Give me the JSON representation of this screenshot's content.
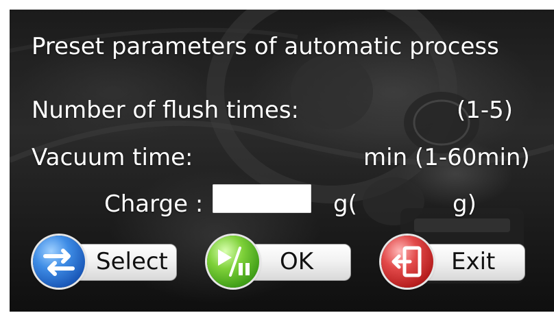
{
  "title": "Preset parameters of automatic process",
  "rows": {
    "flush_label": "Number of flush times:",
    "flush_range": "(1-5)",
    "vacuum_label": "Vacuum time:",
    "vacuum_range": "min (1-60min)",
    "charge_label": "Charge :",
    "charge_unit": "g(",
    "charge_unit_close": "g)",
    "charge_value": ""
  },
  "buttons": {
    "select_label": "Select",
    "ok_label": "OK",
    "exit_label": "Exit"
  },
  "icons": {
    "select": "swap-arrows-icon",
    "ok": "play-pause-icon",
    "exit": "exit-door-icon"
  },
  "colors": {
    "text": "#ffffff",
    "select_accent": "#1a58b8",
    "ok_accent": "#3f9d17",
    "exit_accent": "#b51d1d"
  }
}
